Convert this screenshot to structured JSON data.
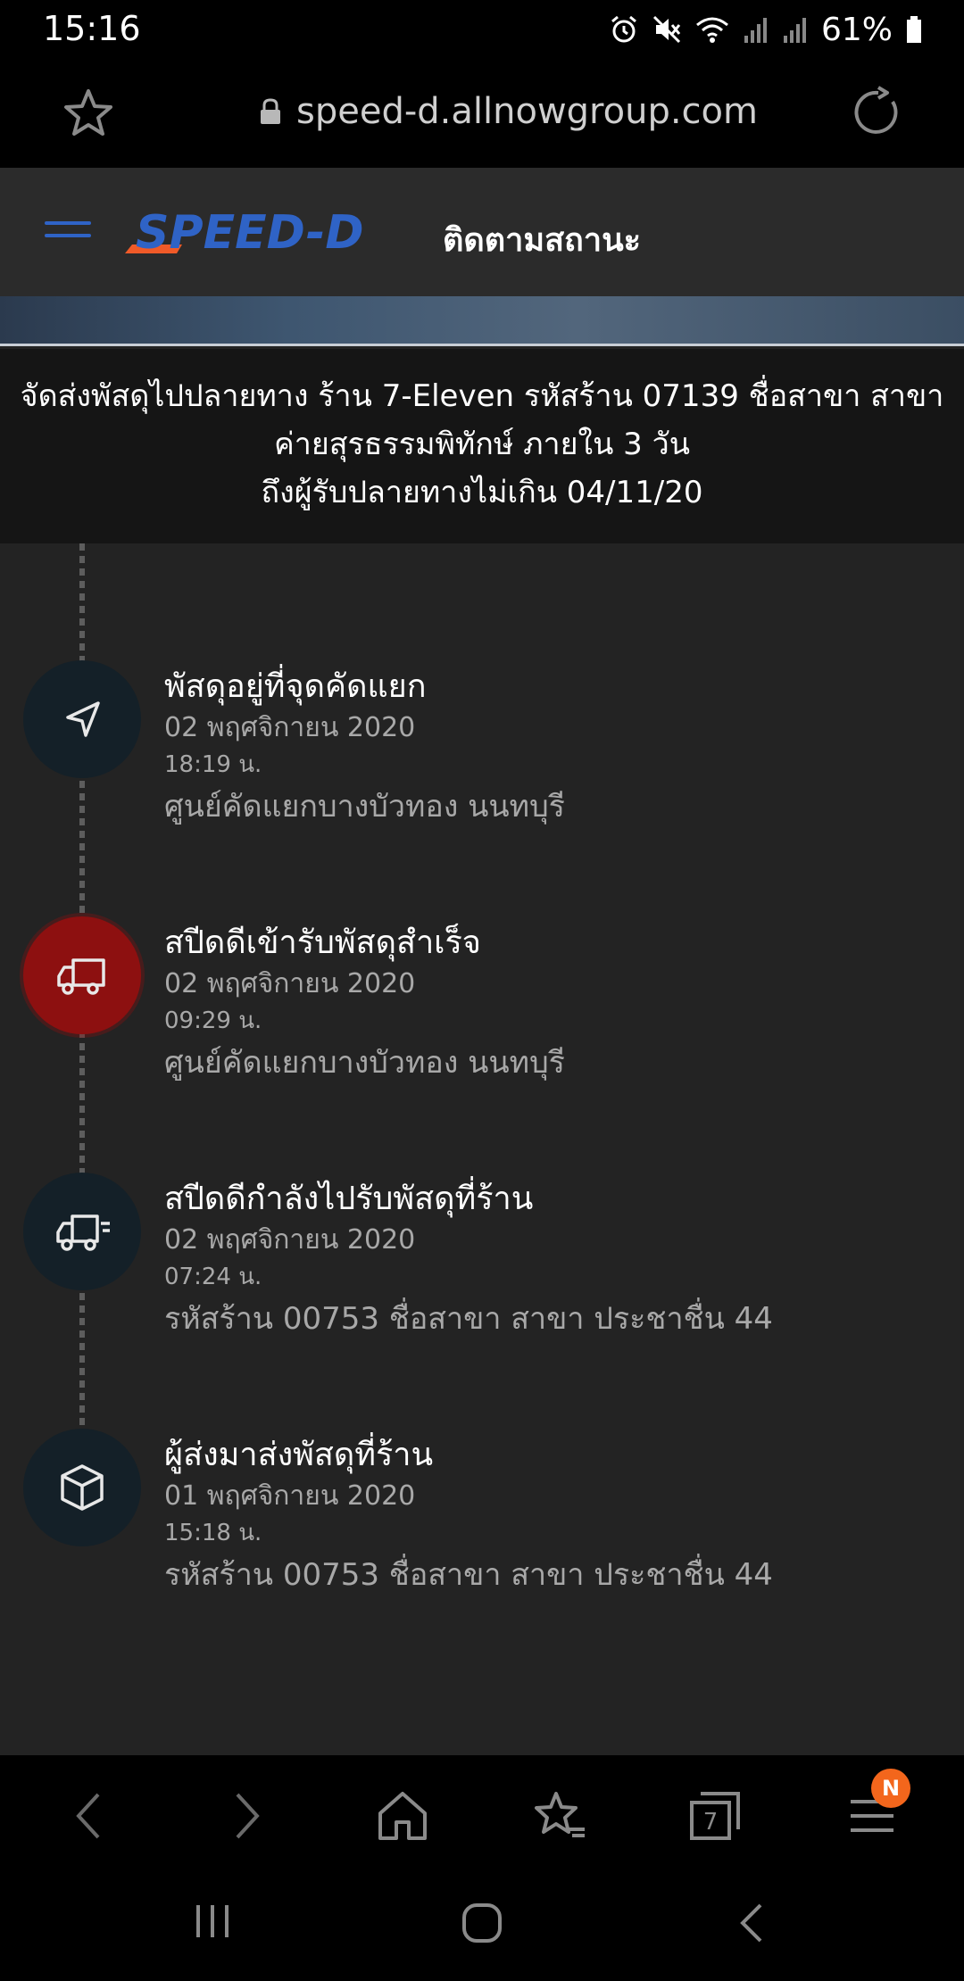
{
  "status_bar": {
    "time": "15:16",
    "battery": "61%",
    "icons": [
      "alarm-icon",
      "mute-icon",
      "wifi-icon",
      "signal-icon",
      "signal-icon",
      "battery-icon"
    ]
  },
  "browser": {
    "url": "speed-d.allnowgroup.com",
    "tab_count": "7",
    "menu_badge": "N"
  },
  "header": {
    "logo_text": "SPEED-D",
    "title": "ติดตามสถานะ"
  },
  "notice": {
    "line1": "จัดส่งพัสดุไปปลายทาง ร้าน 7-Eleven รหัสร้าน 07139 ชื่อสาขา สาขา",
    "line2": "ค่ายสุรธรรมพิทักษ์ ภายใน 3 วัน",
    "line3": "ถึงผู้รับปลายทางไม่เกิน 04/11/20"
  },
  "events": [
    {
      "title": "พัสดุอยู่ที่จุดคัดแยก",
      "date": "02 พฤศจิกายน 2020",
      "time": "18:19 น.",
      "place": "ศูนย์คัดแยกบางบัวทอง นนทบุรี",
      "icon": "navigation-arrow-icon"
    },
    {
      "title": "สปีดดีเข้ารับพัสดุสำเร็จ",
      "date": "02 พฤศจิกายน 2020",
      "time": "09:29 น.",
      "place": "ศูนย์คัดแยกบางบัวทอง นนทบุรี",
      "icon": "truck-icon"
    },
    {
      "title": "สปีดดีกำลังไปรับพัสดุที่ร้าน",
      "date": "02 พฤศจิกายน 2020",
      "time": "07:24 น.",
      "place": "รหัสร้าน 00753 ชื่อสาขา สาขา ประชาชื่น 44",
      "icon": "fast-truck-icon"
    },
    {
      "title": "ผู้ส่งมาส่งพัสดุที่ร้าน",
      "date": "01 พฤศจิกายน 2020",
      "time": "15:18 น.",
      "place": "รหัสร้าน 00753 ชื่อสาขา สาขา ประชาชื่น 44",
      "icon": "package-box-icon"
    }
  ],
  "colors": {
    "accent_blue": "#2f63c6",
    "logo_orange": "#f05a28",
    "active_red": "#8d1010",
    "badge_orange": "#f3661c"
  }
}
